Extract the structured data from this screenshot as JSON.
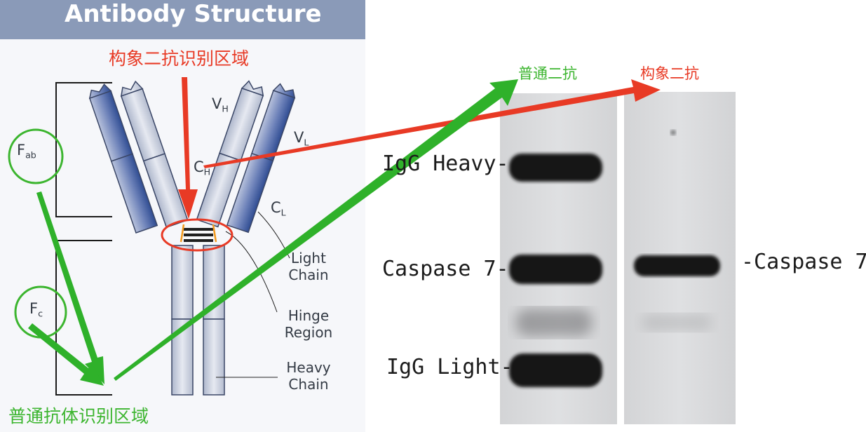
{
  "left": {
    "title": "Antibody Structure",
    "conformational_label": "构象二抗识别区域",
    "normal_label": "普通抗体识别区域",
    "fab": {
      "main": "F",
      "sub": "ab"
    },
    "fc": {
      "main": "F",
      "sub": "c"
    },
    "vh": {
      "main": "V",
      "sub": "H"
    },
    "vl": {
      "main": "V",
      "sub": "L"
    },
    "ch": {
      "main": "C",
      "sub": "H"
    },
    "cl": {
      "main": "C",
      "sub": "L"
    },
    "light_chain": [
      "Light",
      "Chain"
    ],
    "hinge_region": [
      "Hinge",
      "Region"
    ],
    "heavy_chain": [
      "Heavy",
      "Chain"
    ]
  },
  "blot": {
    "lane1_title": "普通二抗",
    "lane2_title": "构象二抗",
    "left_labels": [
      "IgG Heavy-",
      "Caspase 7-",
      "IgG Light-"
    ],
    "right_label": "-Caspase 7"
  },
  "colors": {
    "red": "#e83a25",
    "green": "#3cb52f",
    "title_bar": "#8a9ab8",
    "domain_dark": "#3f5a9c",
    "domain_light": "#c9cfe0"
  }
}
